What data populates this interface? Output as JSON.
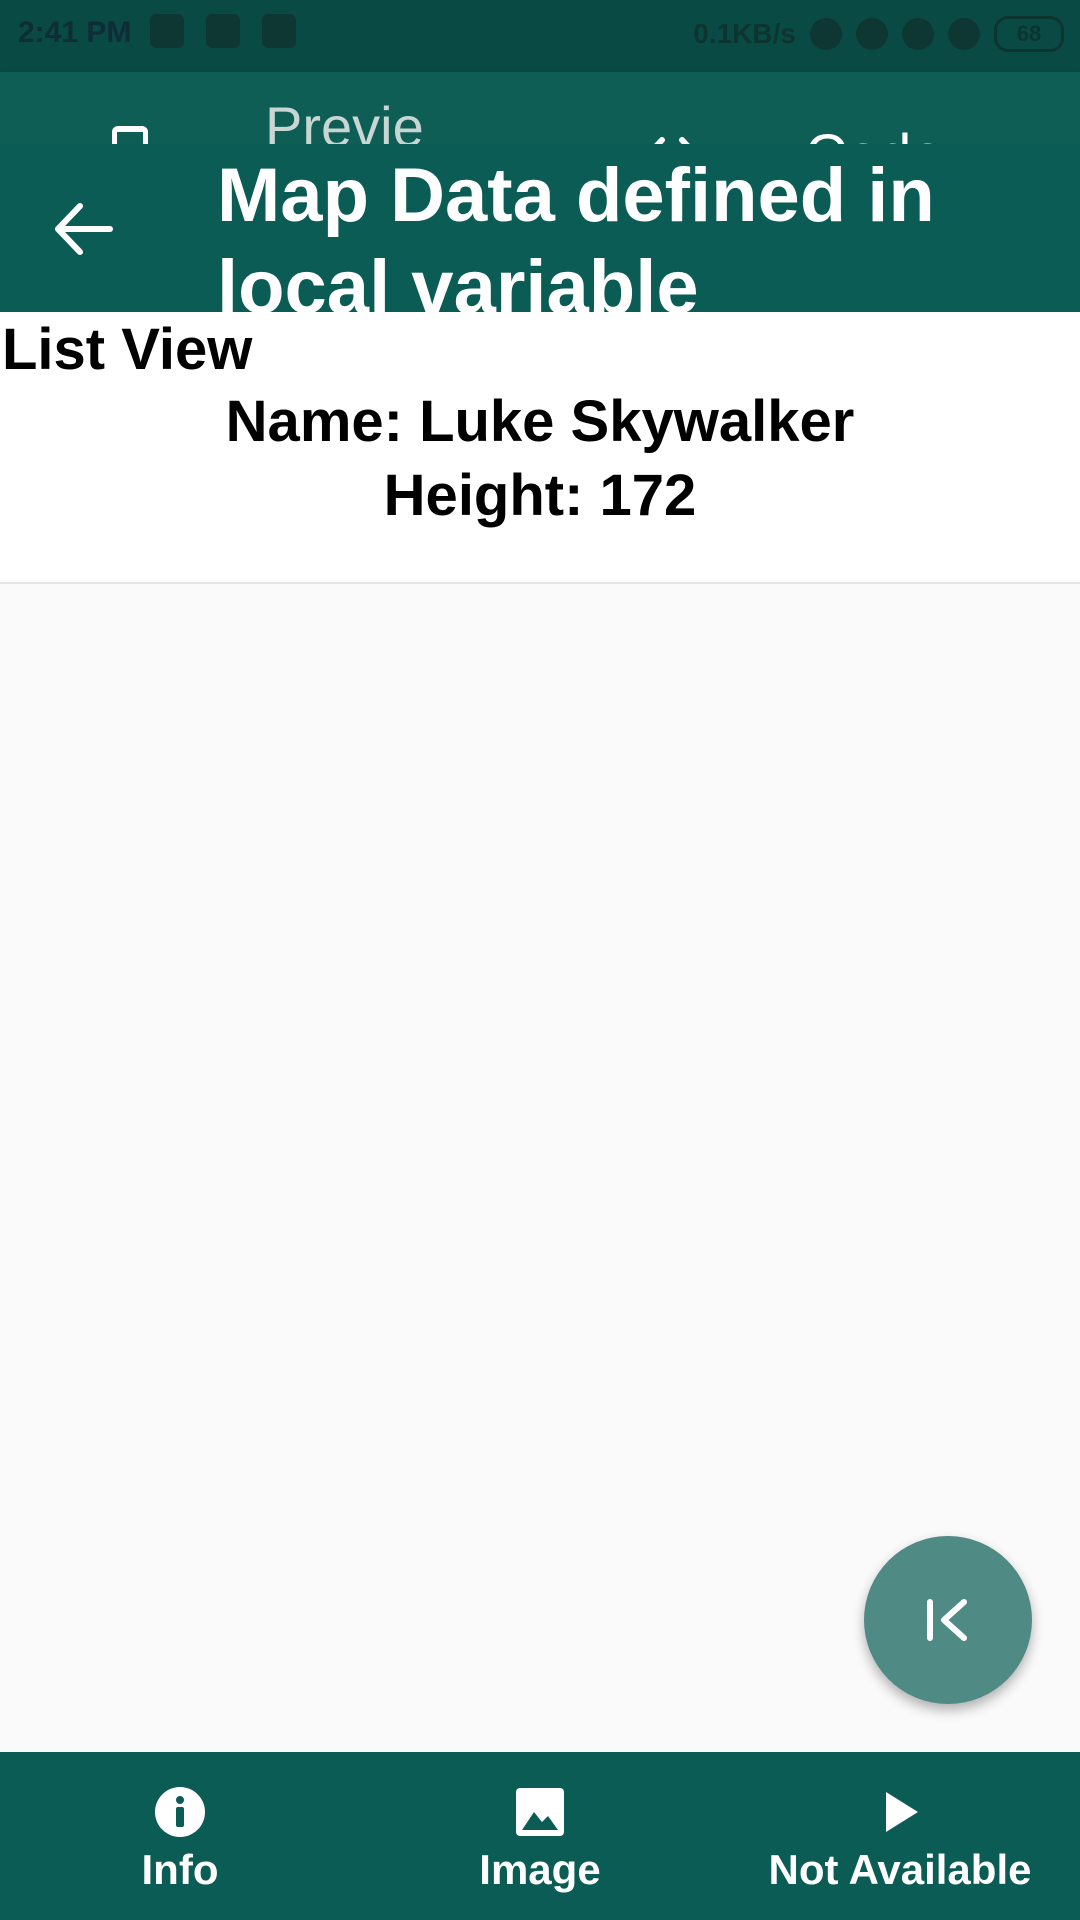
{
  "status_bar": {
    "time": "2:41 PM",
    "net_speed": "0.1KB/s",
    "battery": "68",
    "icons": [
      "youtube-icon",
      "trash-icon",
      "warning-icon",
      "mute-icon",
      "alarm-icon",
      "volte-icon",
      "signal-icon"
    ]
  },
  "top_tabs": {
    "preview_label": "Preview",
    "code_label": "Code"
  },
  "app_bar": {
    "title": "Map Data defined in local variable"
  },
  "content": {
    "heading": "List View",
    "items": [
      {
        "name": "Name: Luke Skywalker",
        "height": "Height: 172"
      }
    ]
  },
  "bottom_nav": {
    "items": [
      {
        "label": "Info",
        "icon": "info-icon"
      },
      {
        "label": "Image",
        "icon": "image-icon"
      },
      {
        "label": "Not Available",
        "icon": "play-icon"
      }
    ]
  },
  "colors": {
    "primary": "#0b5c54",
    "fab": "#4f8a84",
    "background": "#fafafa"
  }
}
